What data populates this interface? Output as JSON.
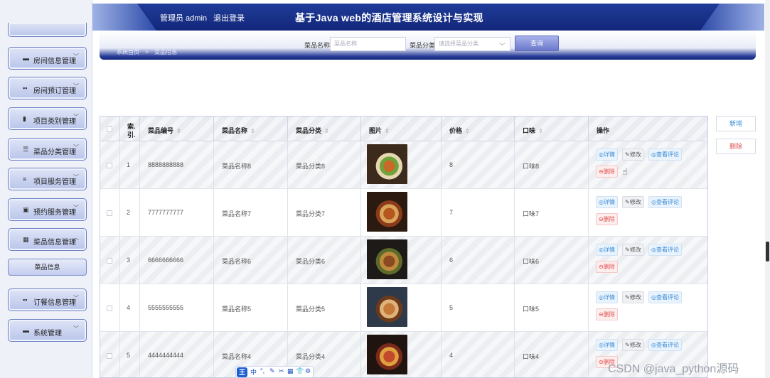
{
  "header": {
    "user_label": "管理员 admin",
    "logout": "退出登录",
    "title": "基于Java web的酒店管理系统设计与实现"
  },
  "breadcrumb": [
    "系统首页",
    ">",
    "菜品信息"
  ],
  "search": {
    "name_label": "菜品名称",
    "name_placeholder": "菜品名称",
    "category_label": "菜品分类",
    "category_placeholder": "请选择菜品分类",
    "query_button": "查询"
  },
  "sidebar": {
    "items": [
      {
        "label": "房间信息管理",
        "icon": "chat-icon"
      },
      {
        "label": "房间预订管理",
        "icon": "grid-icon"
      },
      {
        "label": "项目类别管理",
        "icon": "bar-chart-icon"
      },
      {
        "label": "菜品分类管理",
        "icon": "sliders-icon"
      },
      {
        "label": "项目服务管理",
        "icon": "list-icon"
      },
      {
        "label": "预约服务管理",
        "icon": "trash-icon"
      },
      {
        "label": "菜品信息管理",
        "icon": "grid-icon"
      },
      {
        "label": "订餐信息管理",
        "icon": "grid-icon"
      },
      {
        "label": "系统管理",
        "icon": "monitor-icon"
      }
    ],
    "active_sub": "菜品信息"
  },
  "actions": {
    "add": "新增",
    "delete": "删除"
  },
  "table": {
    "headers": [
      "索引",
      "菜品编号",
      "菜品名称",
      "菜品分类",
      "图片",
      "价格",
      "口味",
      "操作"
    ],
    "index_header_top": "索.",
    "index_header_bottom": "引.",
    "rows": [
      {
        "idx": "1",
        "code": "8888888888",
        "name": "菜品名称8",
        "category": "菜品分类8",
        "price": "8",
        "taste": "口味8"
      },
      {
        "idx": "2",
        "code": "7777777777",
        "name": "菜品名称7",
        "category": "菜品分类7",
        "price": "7",
        "taste": "口味7"
      },
      {
        "idx": "3",
        "code": "6666666666",
        "name": "菜品名称6",
        "category": "菜品分类6",
        "price": "6",
        "taste": "口味6"
      },
      {
        "idx": "4",
        "code": "5555555555",
        "name": "菜品名称5",
        "category": "菜品分类5",
        "price": "5",
        "taste": "口味5"
      },
      {
        "idx": "5",
        "code": "4444444444",
        "name": "菜品名称4",
        "category": "菜品分类4",
        "price": "4",
        "taste": "口味4"
      }
    ],
    "ops": {
      "detail": "◎详情",
      "edit": "✎修改",
      "review": "◎查看评论",
      "delete": "⊖删除"
    }
  },
  "ime_toolbar": {
    "badge": "王",
    "keys": [
      "中",
      "°,",
      "✎",
      "✂",
      "▦",
      "👕",
      "⚙"
    ]
  },
  "watermark": "CSDN @java_python源码"
}
